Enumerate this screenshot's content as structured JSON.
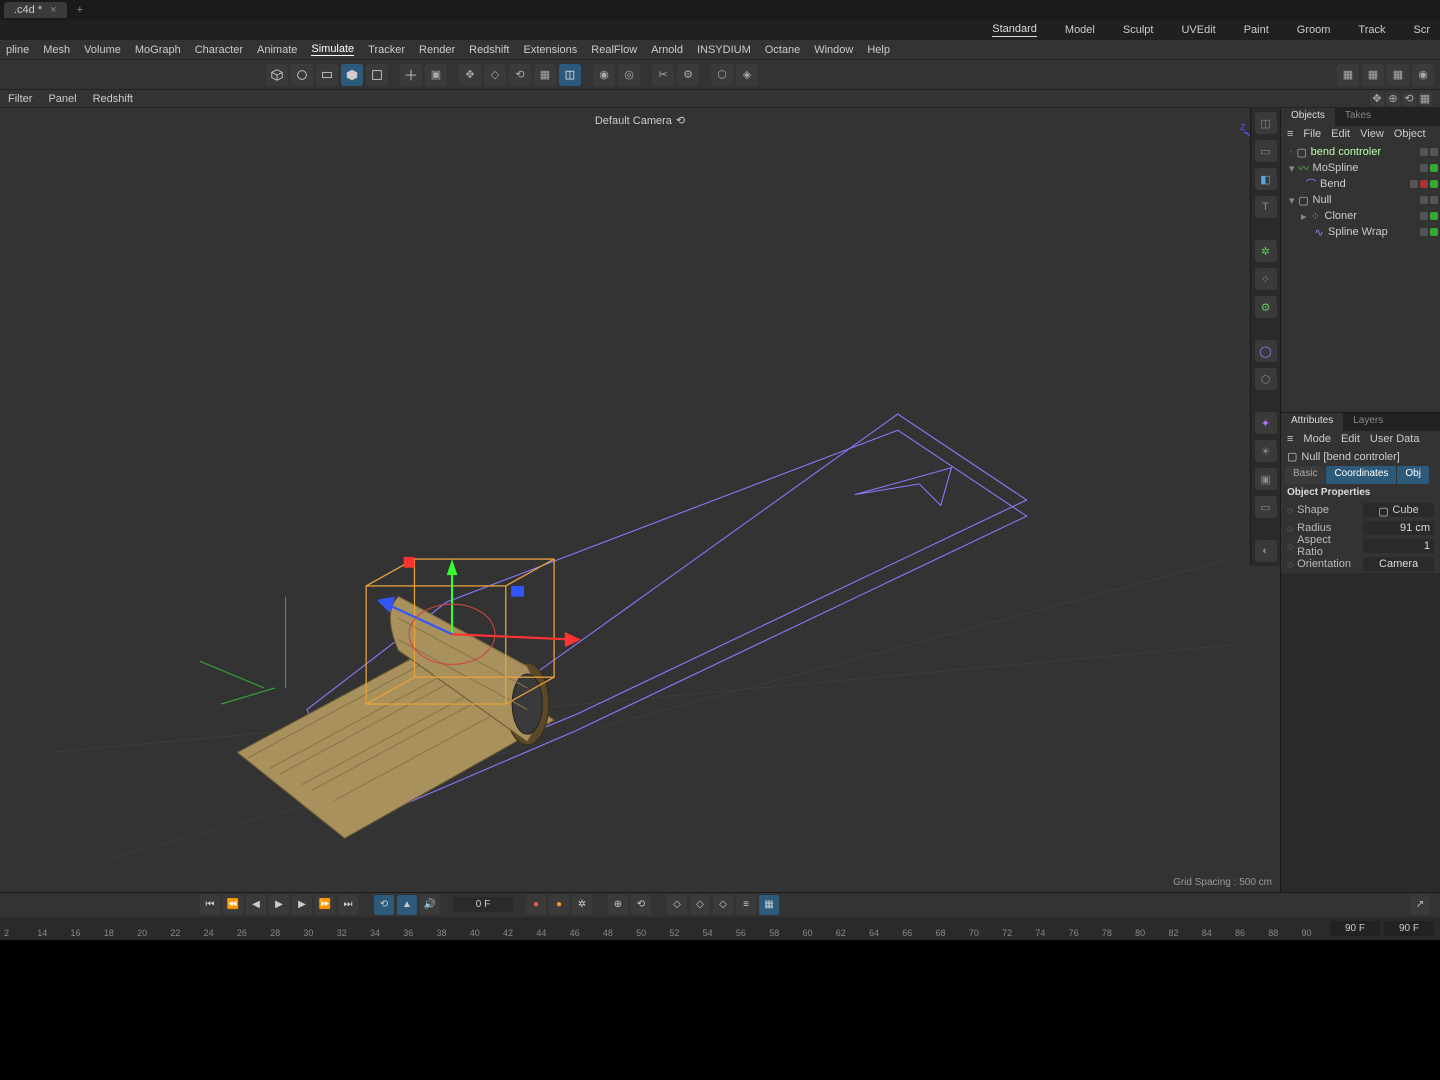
{
  "file": {
    "name": ".c4d *"
  },
  "workspaces": [
    "Standard",
    "Model",
    "Sculpt",
    "UVEdit",
    "Paint",
    "Groom",
    "Track",
    "Scr"
  ],
  "workspace_active": "Standard",
  "menu": [
    "pline",
    "Mesh",
    "Volume",
    "MoGraph",
    "Character",
    "Animate",
    "Simulate",
    "Tracker",
    "Render",
    "Redshift",
    "Extensions",
    "RealFlow",
    "Arnold",
    "INSYDIUM",
    "Octane",
    "Window",
    "Help"
  ],
  "menu_active": "Simulate",
  "subbar": [
    "Filter",
    "Panel",
    "Redshift"
  ],
  "viewport": {
    "camera": "Default Camera",
    "grid_info": "Grid Spacing : 500 cm"
  },
  "objects_panel": {
    "tabs": [
      "Objects",
      "Takes"
    ],
    "active": "Objects",
    "menu": [
      "File",
      "Edit",
      "View",
      "Object"
    ],
    "tree": [
      {
        "indent": 0,
        "icon": "null",
        "name": "bend controler",
        "sel": true
      },
      {
        "indent": 0,
        "icon": "mospline",
        "name": "MoSpline"
      },
      {
        "indent": 1,
        "icon": "bend",
        "name": "Bend"
      },
      {
        "indent": 0,
        "icon": "null",
        "name": "Null"
      },
      {
        "indent": 1,
        "icon": "cloner",
        "name": "Cloner"
      },
      {
        "indent": 2,
        "icon": "wrap",
        "name": "Spline Wrap"
      }
    ]
  },
  "attributes_panel": {
    "tabs": [
      "Attributes",
      "Layers"
    ],
    "active": "Attributes",
    "menu": [
      "Mode",
      "Edit",
      "User Data"
    ],
    "title": "Null [bend controler]",
    "subtabs": [
      "Basic",
      "Coordinates",
      "Obj"
    ],
    "section": "Object Properties",
    "props": {
      "shape": {
        "label": "Shape",
        "value": "Cube"
      },
      "radius": {
        "label": "Radius",
        "value": "91 cm"
      },
      "aspect": {
        "label": "Aspect Ratio",
        "value": "1"
      },
      "orient": {
        "label": "Orientation",
        "value": "Camera"
      }
    }
  },
  "timeline": {
    "current": "0 F",
    "end1": "90 F",
    "end2": "90 F",
    "ticks": [
      2,
      14,
      16,
      18,
      20,
      22,
      24,
      26,
      28,
      30,
      32,
      34,
      36,
      38,
      40,
      42,
      44,
      46,
      48,
      50,
      52,
      54,
      56,
      58,
      60,
      62,
      64,
      66,
      68,
      70,
      72,
      74,
      76,
      78,
      80,
      82,
      84,
      86,
      88,
      90
    ]
  },
  "chart_data": {
    "type": "table",
    "title": "Null [bend controler] Object Properties",
    "categories": [
      "Shape",
      "Radius",
      "Aspect Ratio",
      "Orientation"
    ],
    "values": [
      "Cube",
      "91 cm",
      "1",
      "Camera"
    ]
  }
}
